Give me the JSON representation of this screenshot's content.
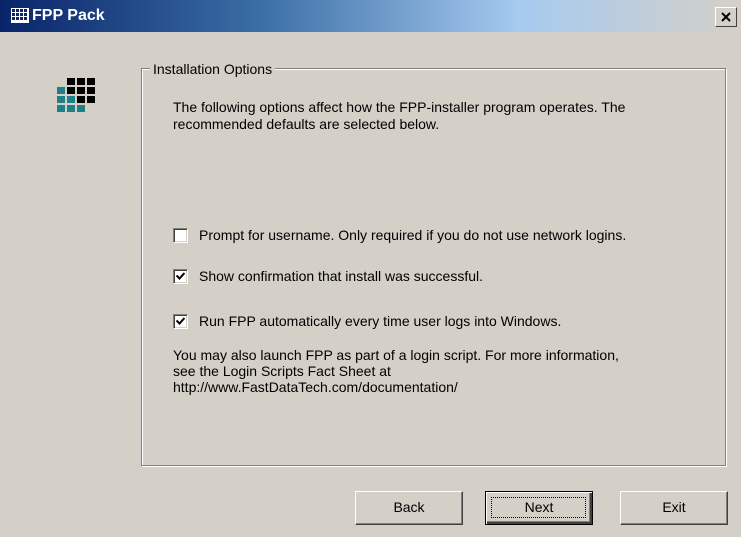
{
  "window": {
    "title": "FPP Pack",
    "close_glyph": "✕"
  },
  "group": {
    "legend": "Installation Options",
    "intro": "The following options affect how the FPP-installer program operates.  The recommended defaults are selected below."
  },
  "options": [
    {
      "label": "Prompt for username.  Only required if you do not use network logins.",
      "checked": false
    },
    {
      "label": "Show confirmation that install was successful.",
      "checked": true
    },
    {
      "label": "Run FPP automatically every time user logs into Windows.",
      "checked": true
    }
  ],
  "note": {
    "line1": "You may also launch FPP as part of a login script.  For more information,",
    "line2": "see the Login Scripts Fact Sheet at",
    "line3": "http://www.FastDataTech.com/documentation/"
  },
  "buttons": {
    "back": "Back",
    "next": "Next",
    "exit": "Exit"
  },
  "colors": {
    "logo_black": "#000000",
    "logo_teal": "#1f7f86",
    "titlebar_start": "#0a246a"
  }
}
